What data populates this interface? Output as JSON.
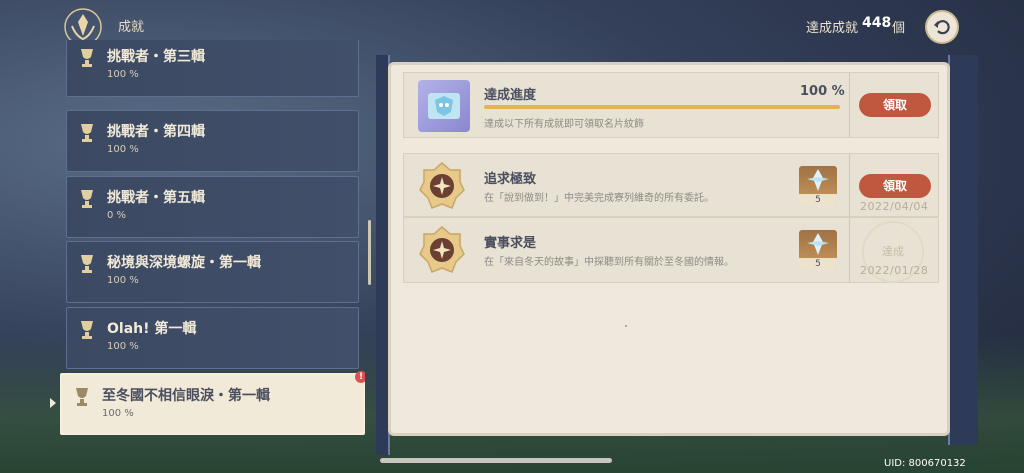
{
  "header": {
    "title": "成就",
    "count_label": "達成成就",
    "count_value": "448",
    "count_unit": "個"
  },
  "categories": [
    {
      "name": "挑戰者・第三輯",
      "percent": "100 %"
    },
    {
      "name": "挑戰者・第四輯",
      "percent": "100 %"
    },
    {
      "name": "挑戰者・第五輯",
      "percent": "0 %"
    },
    {
      "name": "秘境與深境螺旋・第一輯",
      "percent": "100 %"
    },
    {
      "name": "Olah! 第一輯",
      "percent": "100 %"
    },
    {
      "name": "至冬國不相信眼淚・第一輯",
      "percent": "100 %",
      "alert": "!"
    }
  ],
  "progress": {
    "title": "達成進度",
    "percent_text": "100 %",
    "fill_fraction": 1.0,
    "description": "達成以下所有成就即可領取名片紋飾",
    "claim_label": "領取"
  },
  "achievements": [
    {
      "title": "追求極致",
      "description": "在「說到做到！」中完美完成寮列維奇的所有委託。",
      "reward_count": "5",
      "claim_label": "領取",
      "date": "2022/04/04"
    },
    {
      "title": "實事求是",
      "description": "在「來自冬天的故事」中探聽到所有關於至冬國的情報。",
      "reward_count": "5",
      "stamp_label": "達成",
      "date": "2022/01/28"
    }
  ],
  "footer": {
    "uid": "UID: 800670132"
  },
  "colors": {
    "accent_claim": "#c0573f",
    "progress_fill": "#e8b44a",
    "panel_bg": "#efe9dd"
  }
}
